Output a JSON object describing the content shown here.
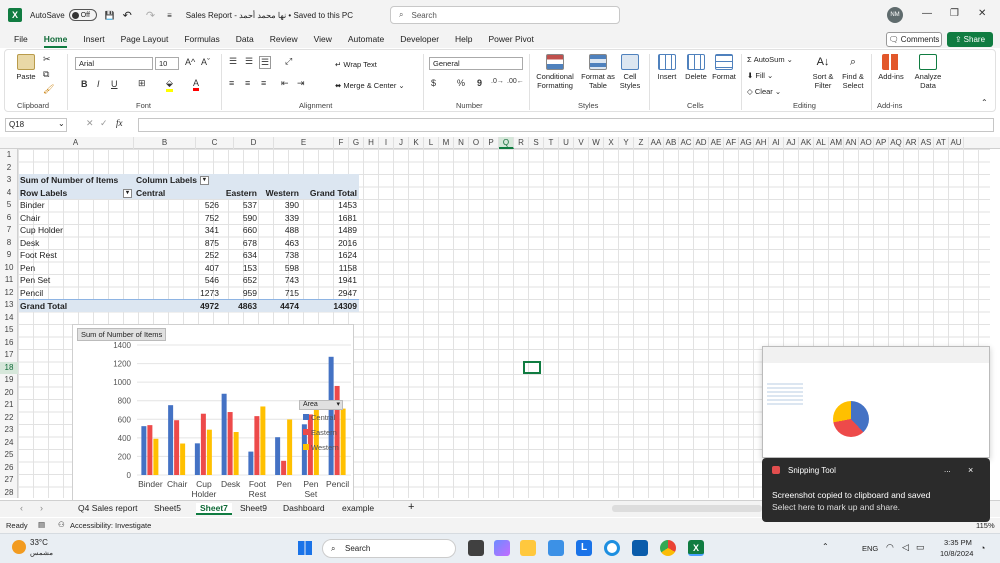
{
  "titlebar": {
    "autosave": "AutoSave",
    "autosave_state": "Off",
    "doc_title": "Sales Report - نها محمد أحمد • Saved to this PC",
    "search_placeholder": "Search",
    "avatar": "NM"
  },
  "menu": [
    "File",
    "Home",
    "Insert",
    "Page Layout",
    "Formulas",
    "Data",
    "Review",
    "View",
    "Automate",
    "Developer",
    "Help",
    "Power Pivot"
  ],
  "active_menu": "Home",
  "buttons": {
    "comments": "Comments",
    "share": "Share"
  },
  "ribbon": {
    "clipboard": {
      "label": "Clipboard",
      "paste": "Paste"
    },
    "font": {
      "label": "Font",
      "name": "Arial",
      "size": "10",
      "bold": "B",
      "italic": "I",
      "underline": "U",
      "grow": "A^",
      "shrink": "Aˇ"
    },
    "alignment": {
      "label": "Alignment",
      "wrap": "Wrap Text",
      "merge": "Merge & Center"
    },
    "number": {
      "label": "Number",
      "format": "General",
      "currency": "$",
      "percent": "%",
      "comma": "9"
    },
    "styles": {
      "label": "Styles",
      "conditional": "Conditional Formatting",
      "format_table": "Format as Table",
      "cell_styles": "Cell Styles"
    },
    "cells": {
      "label": "Cells",
      "insert": "Insert",
      "delete": "Delete",
      "format": "Format"
    },
    "editing": {
      "label": "Editing",
      "autosum": "AutoSum",
      "fill": "Fill",
      "clear": "Clear",
      "sort": "Sort & Filter",
      "find": "Find & Select"
    },
    "addins": {
      "label": "Add-ins",
      "addins": "Add-ins",
      "analyze": "Analyze Data"
    }
  },
  "namebox": "Q18",
  "fx": "fx",
  "columns": [
    "A",
    "B",
    "C",
    "D",
    "E",
    "F",
    "G",
    "H",
    "I",
    "J",
    "K",
    "L",
    "M",
    "N",
    "O",
    "P",
    "Q",
    "R",
    "S",
    "T",
    "U",
    "V",
    "W",
    "X",
    "Y",
    "Z",
    "AA",
    "AB",
    "AC",
    "AD",
    "AE",
    "AF",
    "AG",
    "AH",
    "AI",
    "AJ",
    "AK",
    "AL",
    "AM",
    "AN",
    "AO",
    "AP",
    "AQ",
    "AR",
    "AS",
    "AT",
    "AU"
  ],
  "rows": [
    "1",
    "2",
    "3",
    "4",
    "5",
    "6",
    "7",
    "8",
    "9",
    "10",
    "11",
    "12",
    "13",
    "14",
    "15",
    "16",
    "17",
    "18",
    "19",
    "20",
    "21",
    "22",
    "23",
    "24",
    "25",
    "26",
    "27",
    "28"
  ],
  "pivot": {
    "sum_label": "Sum of Number of Items",
    "column_labels": "Column Labels",
    "row_labels": "Row Labels",
    "headers": [
      "Central",
      "Eastern",
      "Western",
      "Grand Total"
    ],
    "rows": [
      {
        "name": "Binder",
        "values": [
          "526",
          "537",
          "390",
          "1453"
        ]
      },
      {
        "name": "Chair",
        "values": [
          "752",
          "590",
          "339",
          "1681"
        ]
      },
      {
        "name": "Cup Holder",
        "values": [
          "341",
          "660",
          "488",
          "1489"
        ]
      },
      {
        "name": "Desk",
        "values": [
          "875",
          "678",
          "463",
          "2016"
        ]
      },
      {
        "name": "Foot Rest",
        "values": [
          "252",
          "634",
          "738",
          "1624"
        ]
      },
      {
        "name": "Pen",
        "values": [
          "407",
          "153",
          "598",
          "1158"
        ]
      },
      {
        "name": "Pen Set",
        "values": [
          "546",
          "652",
          "743",
          "1941"
        ]
      },
      {
        "name": "Pencil",
        "values": [
          "1273",
          "959",
          "715",
          "2947"
        ]
      }
    ],
    "grand_total": {
      "name": "Grand Total",
      "values": [
        "4972",
        "4863",
        "4474",
        "14309"
      ]
    }
  },
  "chart_data": {
    "type": "bar",
    "title": "Sum of Number of Items",
    "categories": [
      "Binder",
      "Chair",
      "Cup Holder",
      "Desk",
      "Foot Rest",
      "Pen",
      "Pen Set",
      "Pencil"
    ],
    "series": [
      {
        "name": "Central",
        "color": "#4472c4",
        "values": [
          526,
          752,
          341,
          875,
          252,
          407,
          546,
          1273
        ]
      },
      {
        "name": "Eastern",
        "color": "#ed4a4a",
        "values": [
          537,
          590,
          660,
          678,
          634,
          153,
          652,
          959
        ]
      },
      {
        "name": "Western",
        "color": "#ffc000",
        "values": [
          390,
          339,
          488,
          463,
          738,
          598,
          743,
          715
        ]
      }
    ],
    "ylim": [
      0,
      1400
    ],
    "yticks": [
      0,
      200,
      400,
      600,
      800,
      1000,
      1200,
      1400
    ],
    "legend_title": "Area",
    "legend_placement": "right"
  },
  "sheet_tabs": [
    "Q4 Sales report",
    "Sheet5",
    "Sheet7",
    "Sheet9",
    "Dashboard",
    "example"
  ],
  "active_sheet": "Sheet7",
  "status": {
    "ready": "Ready",
    "accessibility": "Accessibility: Investigate",
    "zoom": "115%"
  },
  "taskbar": {
    "temp": "33°C",
    "weather": "مشمس",
    "search": "Search",
    "lang": "ENG",
    "time": "3:35 PM",
    "date": "10/8/2024"
  },
  "toast": {
    "app": "Snipping Tool",
    "title": "Screenshot copied to clipboard and saved",
    "body": "Select here to mark up and share.",
    "more": "...",
    "close": "×"
  }
}
